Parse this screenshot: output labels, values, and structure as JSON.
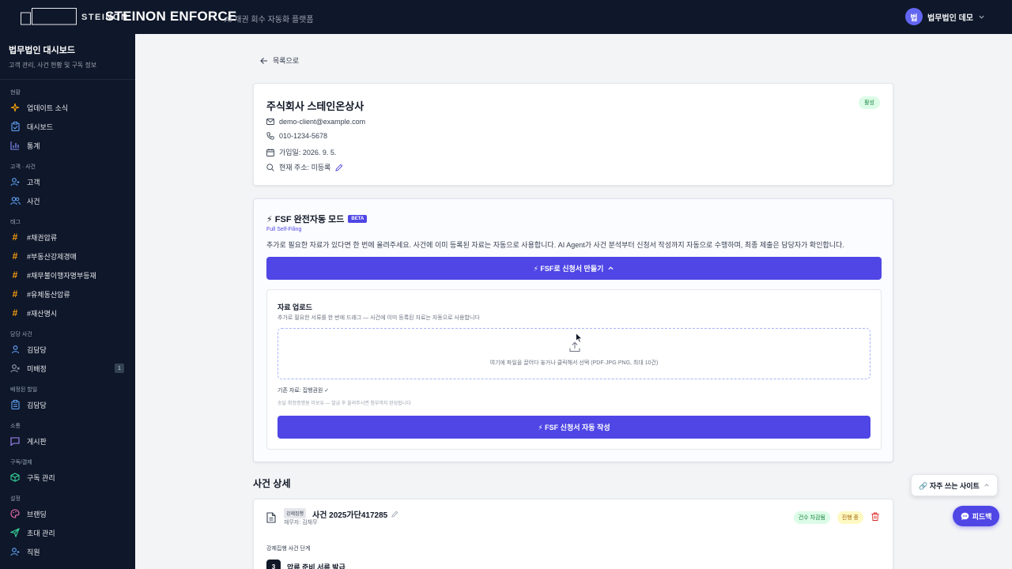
{
  "topbar": {
    "logo_small": "STEINON",
    "brand_title": "STEINON ENFORCE",
    "brand_sub": "AI 채권 회수 자동화 플랫폼",
    "user_avatar": "법",
    "user_name": "법무법인 데모",
    "user_chevron_icon": "chevron-down-icon"
  },
  "sidebar": {
    "title": "법무법인 대시보드",
    "desc": "고객 관리, 사건 현황 및 구독 정보",
    "sections": [
      {
        "label": "현황",
        "items": [
          {
            "label": "업데이트 소식",
            "icon": "sparkle-icon"
          },
          {
            "label": "대시보드",
            "icon": "clipboard-icon"
          },
          {
            "label": "통계",
            "icon": "bar-chart-icon"
          }
        ]
      },
      {
        "label": "고객 · 사건",
        "items": [
          {
            "label": "고객",
            "icon": "user-plus-icon"
          },
          {
            "label": "사건",
            "icon": "users-icon"
          }
        ]
      },
      {
        "label": "태그",
        "items": [
          {
            "label": "#채권압류",
            "icon": "hash-icon"
          },
          {
            "label": "#부동산강제경매",
            "icon": "hash-icon"
          },
          {
            "label": "#채무불이행자명부등재",
            "icon": "hash-icon"
          },
          {
            "label": "#유체동산압류",
            "icon": "hash-icon"
          },
          {
            "label": "#재산명시",
            "icon": "hash-icon"
          }
        ]
      },
      {
        "label": "담당 사건",
        "items": [
          {
            "label": "김담당",
            "icon": "user-icon"
          },
          {
            "label": "미배정",
            "icon": "user-x-icon",
            "badge": "1"
          }
        ]
      },
      {
        "label": "배정된 할일",
        "items": [
          {
            "label": "김담당",
            "icon": "clipboard-icon"
          }
        ]
      },
      {
        "label": "소통",
        "items": [
          {
            "label": "게시판",
            "icon": "message-icon"
          }
        ]
      },
      {
        "label": "구독/결제",
        "items": [
          {
            "label": "구독 관리",
            "icon": "box-icon"
          }
        ]
      },
      {
        "label": "설정",
        "items": [
          {
            "label": "브랜딩",
            "icon": "palette-icon"
          },
          {
            "label": "초대 관리",
            "icon": "send-icon"
          },
          {
            "label": "직원",
            "icon": "user-plus-icon"
          }
        ]
      }
    ]
  },
  "main": {
    "back_label": "목록으로",
    "client": {
      "name": "주식회사 스테인온상사",
      "status": "활성",
      "email": "demo-client@example.com",
      "phone": "010-1234-5678",
      "joined": "가입일: 2026. 9. 5.",
      "address": "현재 주소: 미등록"
    },
    "fsf": {
      "title": "⚡ FSF 완전자동 모드",
      "beta": "BETA",
      "subtitle": "Full Self-Filing",
      "description": "추가로 필요한 자료가 있다면 한 번에 올려주세요. 사건에 이미 등록된 자료는 자동으로 사용합니다. AI Agent가 사건 분석부터 신청서 작성까지 자동으로 수행하며, 최종 제출은 담당자가 확인합니다.",
      "create_button": "⚡ FSF로 신청서 만들기",
      "upload": {
        "title": "자료 업로드",
        "desc": "추가로 필요한 서류를 한 번에 드래그 — 사건에 이미 등록된 자료는 자동으로 사용합니다",
        "dropzone_text": "여기에 파일을 끌어다 놓거나 클릭해서 선택 (PDF·JPG·PNG, 최대 10건)",
        "existing": "기존 자료: 집행권원 ✓",
        "note": "송달·확정증명원 미보유 — 발급 후 올려주시면 첨부까지 완성됩니다",
        "auto_button": "⚡ FSF 신청서 자동 작성"
      }
    },
    "case_section_title": "사건 상세",
    "case": {
      "tag": "강제집행",
      "number": "사건 2025가단417285",
      "debtor": "채무자: 김채무",
      "pill_assets": "건수 차감됨",
      "pill_status": "진행 중",
      "stage_label": "강제집행 사건 단계",
      "step_number": "3",
      "step_name": "압류 준비 서류 발급"
    }
  },
  "floating": {
    "sites_label": "🔗 자주 쓰는 사이트",
    "feedback_label": "피드백"
  },
  "colors": {
    "sidebar_bg": "#0f172a",
    "accent": "#4f46e5",
    "tag_hash": "#f59e0b"
  }
}
